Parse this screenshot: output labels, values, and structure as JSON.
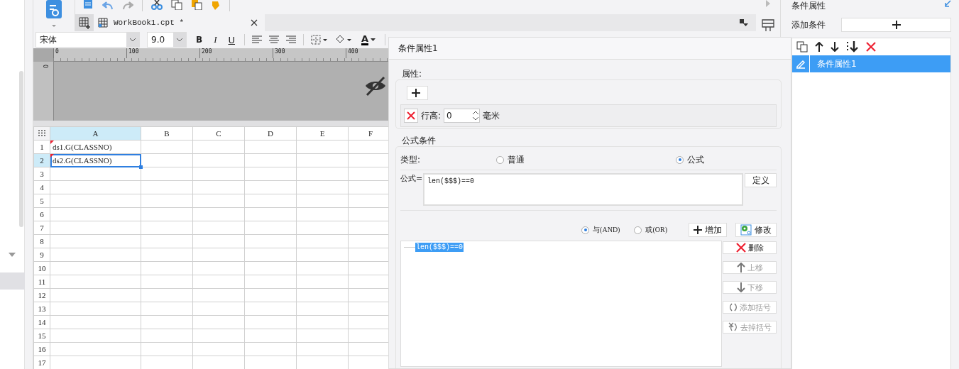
{
  "tab": {
    "title": "WorkBook1.cpt *"
  },
  "format_toolbar": {
    "font": "宋体",
    "size": "9.0",
    "bold": "B",
    "italic": "I",
    "underline": "U",
    "font_color": "A"
  },
  "ruler": {
    "ticks": [
      "0",
      "100",
      "200",
      "300",
      "400"
    ],
    "vertical_tick": "0"
  },
  "sheet": {
    "columns": [
      {
        "label": "A",
        "selected": true
      },
      {
        "label": "B",
        "selected": false
      },
      {
        "label": "C",
        "selected": false
      },
      {
        "label": "D",
        "selected": false
      },
      {
        "label": "E",
        "selected": false
      },
      {
        "label": "F",
        "selected": false
      }
    ],
    "rows": [
      {
        "number": "1",
        "selected": false,
        "cell": "ds1.G(CLASSNO)",
        "flagged": true,
        "active": false
      },
      {
        "number": "2",
        "selected": true,
        "cell": "ds2.G(CLASSNO)",
        "flagged": true,
        "active": true
      },
      {
        "number": "3",
        "selected": false
      },
      {
        "number": "4",
        "selected": false
      },
      {
        "number": "5",
        "selected": false
      },
      {
        "number": "6",
        "selected": false
      },
      {
        "number": "7",
        "selected": false
      },
      {
        "number": "8",
        "selected": false
      },
      {
        "number": "9",
        "selected": false
      },
      {
        "number": "10",
        "selected": false
      },
      {
        "number": "11",
        "selected": false
      },
      {
        "number": "12",
        "selected": false
      },
      {
        "number": "13",
        "selected": false
      },
      {
        "number": "14",
        "selected": false
      },
      {
        "number": "15",
        "selected": false
      },
      {
        "number": "16",
        "selected": false
      },
      {
        "number": "17",
        "selected": false
      }
    ]
  },
  "dialog": {
    "title": "条件属性1",
    "attributes": {
      "legend": "属性:",
      "property": {
        "label": "行高:",
        "value": "0",
        "unit": "毫米"
      }
    },
    "formula_condition": {
      "legend": "公式条件",
      "type_label": "类型:",
      "types": [
        {
          "label": "普通",
          "selected": false
        },
        {
          "label": "公式",
          "selected": true
        }
      ],
      "formula_label": "公式=",
      "formula": "len($$$)==0",
      "define_button": "定义",
      "logic": [
        {
          "label": "与(AND)",
          "selected": true
        },
        {
          "label": "或(OR)",
          "selected": false
        }
      ],
      "add_button": "增加",
      "modify_button": "修改",
      "conditions": [
        {
          "text": "len($$$)==0",
          "selected": true
        }
      ],
      "side_buttons": [
        {
          "kind": "delete",
          "label": "删除",
          "disabled": false
        },
        {
          "kind": "up",
          "label": "上移",
          "disabled": true
        },
        {
          "kind": "down",
          "label": "下移",
          "disabled": true
        },
        {
          "kind": "add_bracket",
          "label": "添加括号",
          "disabled": true
        },
        {
          "kind": "remove_bracket",
          "label": "去掉括号",
          "disabled": true
        }
      ]
    }
  },
  "right_panel": {
    "title": "条件属性",
    "add_label": "添加条件",
    "items": [
      {
        "label": "条件属性1",
        "selected": true
      }
    ]
  }
}
